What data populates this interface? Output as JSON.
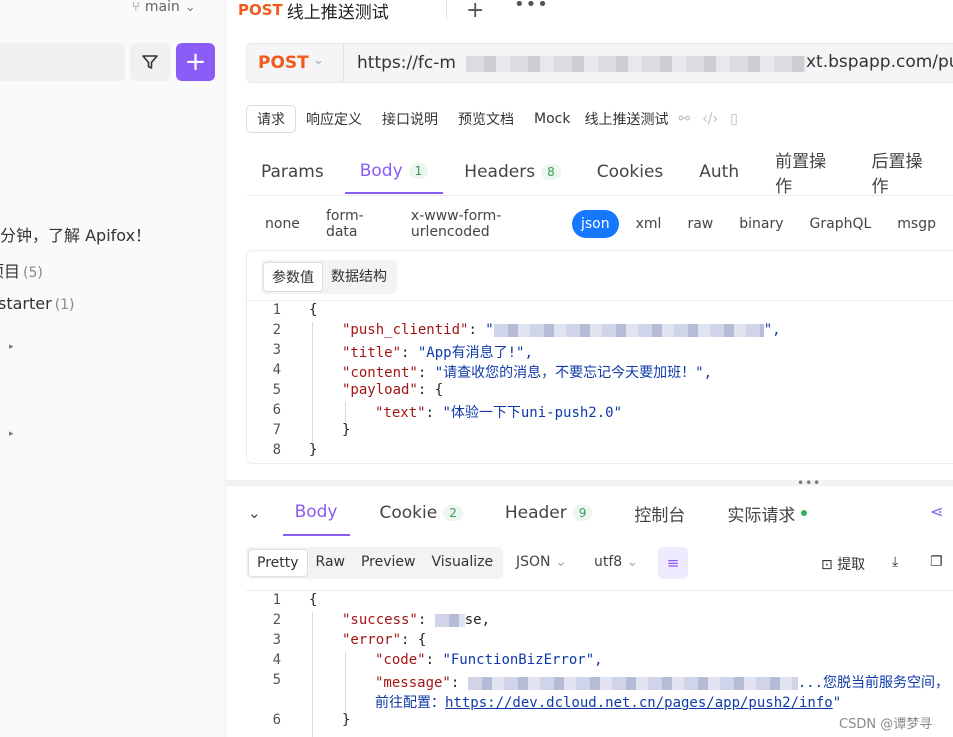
{
  "sidebar": {
    "branch": "main",
    "items": [
      {
        "label": "一分钟，了解 Apifox！",
        "count": ""
      },
      {
        "label": "项目",
        "count": "(5)"
      },
      {
        "label": "starter",
        "count": "(1)"
      }
    ],
    "add_label": "+"
  },
  "top_tab": {
    "method": "POST",
    "title": "线上推送测试",
    "plus": "+",
    "more": "•••"
  },
  "request": {
    "method": "POST",
    "url_start": "https://fc-m",
    "url_end": "xt.bspapp.com/pus"
  },
  "doc_tabs": [
    "请求",
    "响应定义",
    "接口说明",
    "预览文档",
    "Mock"
  ],
  "doc_title": "线上推送测试",
  "req_tabs": [
    {
      "label": "Params",
      "badge": ""
    },
    {
      "label": "Body",
      "badge": "1"
    },
    {
      "label": "Headers",
      "badge": "8"
    },
    {
      "label": "Cookies",
      "badge": ""
    },
    {
      "label": "Auth",
      "badge": ""
    },
    {
      "label": "前置操作",
      "badge": ""
    },
    {
      "label": "后置操作",
      "badge": ""
    }
  ],
  "body_types": [
    "none",
    "form-data",
    "x-www-form-urlencoded",
    "json",
    "xml",
    "raw",
    "binary",
    "GraphQL",
    "msgp"
  ],
  "editor_tabs": [
    "参数值",
    "数据结构"
  ],
  "request_code": {
    "line_numbers": [
      "1",
      "2",
      "3",
      "4",
      "5",
      "6",
      "7",
      "8"
    ],
    "l1": "{",
    "k_push": "\"push_clientid\"",
    "s_push_a": "\"",
    "s_push_b": "\",",
    "k_title": "\"title\"",
    "v_title": "\"App有消息了!\",",
    "k_content": "\"content\"",
    "v_content": "\"请查收您的消息，不要忘记今天要加班！\",",
    "k_payload": "\"payload\"",
    "v_payload": "{",
    "k_text": "\"text\"",
    "v_text": "\"体验一下下uni-push2.0\"",
    "l7": "}",
    "l8": "}",
    "colon": ": "
  },
  "resp_tabs": [
    {
      "label": "Body",
      "badge": ""
    },
    {
      "label": "Cookie",
      "badge": "2"
    },
    {
      "label": "Header",
      "badge": "9"
    },
    {
      "label": "控制台",
      "badge": ""
    },
    {
      "label": "实际请求",
      "badge": ""
    }
  ],
  "resp_view": [
    "Pretty",
    "Raw",
    "Preview",
    "Visualize"
  ],
  "resp_format": "JSON",
  "resp_encoding": "utf8",
  "resp_extract": "提取",
  "response_code": {
    "line_numbers": [
      "1",
      "2",
      "3",
      "4",
      "5",
      "",
      "6"
    ],
    "l1": "{",
    "k_success": "\"success\"",
    "v_success": "se,",
    "k_error": "\"error\"",
    "v_error": "{",
    "k_code": "\"code\"",
    "v_code": "\"FunctionBizError\",",
    "k_message": "\"message\"",
    "v_message_tail": "...您脱当前服务空间，",
    "prefix_link": "前往配置：",
    "link": "https://dev.dcloud.net.cn/pages/app/push2/info",
    "link_tail": "\"",
    "l6": "}",
    "colon": ": "
  },
  "watermark": "CSDN @谭梦寻"
}
